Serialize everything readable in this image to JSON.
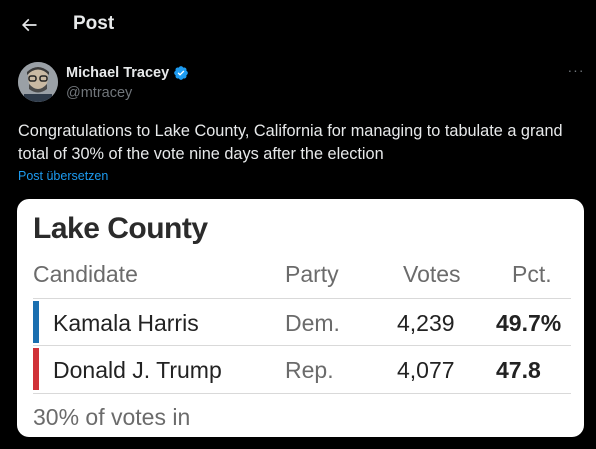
{
  "header": {
    "title": "Post",
    "back_icon": "arrow-left-icon"
  },
  "author": {
    "name": "Michael Tracey",
    "handle": "@mtracey",
    "verified_color": "#1d9bf0",
    "more_label": "···"
  },
  "tweet": {
    "text": "Congratulations to Lake County, California for managing to tabulate a grand total of 30% of the vote nine days after the election",
    "translate_label": "Post übersetzen"
  },
  "results_card": {
    "title": "Lake County",
    "columns": [
      "Candidate",
      "Party",
      "Votes",
      "Pct."
    ],
    "rows": [
      {
        "candidate": "Kamala Harris",
        "party": "Dem.",
        "votes": "4,239",
        "pct": "49.7%",
        "color": "#1a6fb0"
      },
      {
        "candidate": "Donald J. Trump",
        "party": "Rep.",
        "votes": "4,077",
        "pct": "47.8",
        "color": "#d03238"
      }
    ],
    "footer": "30% of votes in"
  },
  "colors": {
    "background": "#000000",
    "link": "#1d9bf0",
    "text_secondary": "#71767b"
  }
}
